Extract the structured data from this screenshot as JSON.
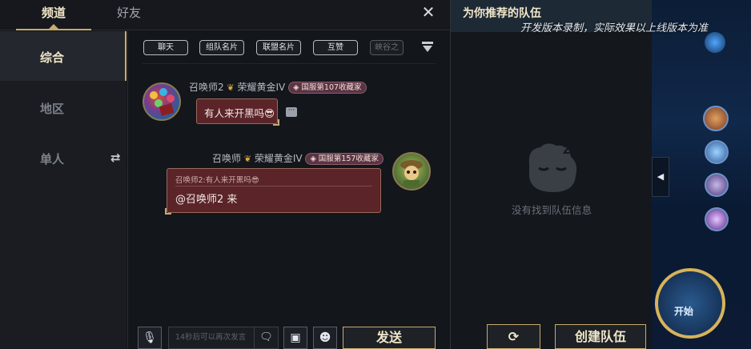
{
  "tabs": {
    "channel": "频道",
    "friends": "好友"
  },
  "close_glyph": "✕",
  "nav": {
    "items": [
      "综合",
      "地区",
      "单人"
    ],
    "active_index": 0
  },
  "filters": [
    "聊天",
    "组队名片",
    "联盟名片",
    "互赞",
    "峡谷之"
  ],
  "messages": [
    {
      "sender": "召唤师2",
      "rank": "荣耀黄金IV",
      "badge": "国服第107收藏家",
      "text": "有人来开黑吗😎"
    },
    {
      "sender": "召唤师",
      "rank": "荣耀黄金IV",
      "badge": "国服第157收藏家",
      "quote": "召唤师2:有人来开黑吗😎",
      "text": "@召唤师2 来"
    }
  ],
  "input": {
    "placeholder": "14秒后可以再次发言",
    "send_label": "发送"
  },
  "team": {
    "title": "为你推荐的队伍",
    "empty_text": "没有找到队伍信息",
    "create_label": "创建队伍"
  },
  "notice": "开发版本录制，实际效果以上线版本为准",
  "game_side": {
    "play_label": "开始"
  },
  "colors": {
    "accent_gold": "#c8aa6e",
    "bubble_red": "#5a2429",
    "header_blue": "#1d2a36"
  },
  "icons": [
    "close-icon",
    "swap-icon",
    "menu-icon",
    "more-icon",
    "voice-toggle-icon",
    "emote-icon",
    "image-icon",
    "smiley-icon",
    "refresh-icon",
    "collapse-icon"
  ]
}
